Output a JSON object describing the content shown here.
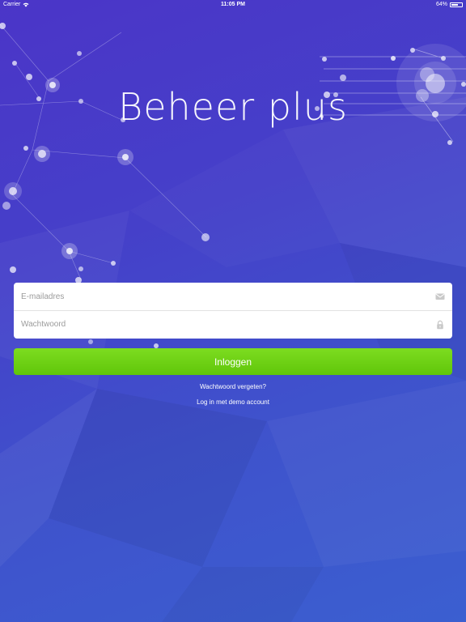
{
  "status_bar": {
    "carrier": "Carrier",
    "time": "11:05 PM",
    "battery": "64%"
  },
  "app": {
    "title": "Beheer plus"
  },
  "login_form": {
    "email_placeholder": "E-mailadres",
    "password_placeholder": "Wachtwoord",
    "email_icon": "envelope-icon",
    "password_icon": "lock-icon",
    "login_button": "Inloggen",
    "forgot_password_link": "Wachtwoord vergeten?",
    "demo_account_link": "Log in met demo account"
  },
  "colors": {
    "background_top": "#4b35c8",
    "background_bottom": "#3b5fd0",
    "login_button": "#6fd214",
    "text_on_dark": "#ffffff"
  }
}
